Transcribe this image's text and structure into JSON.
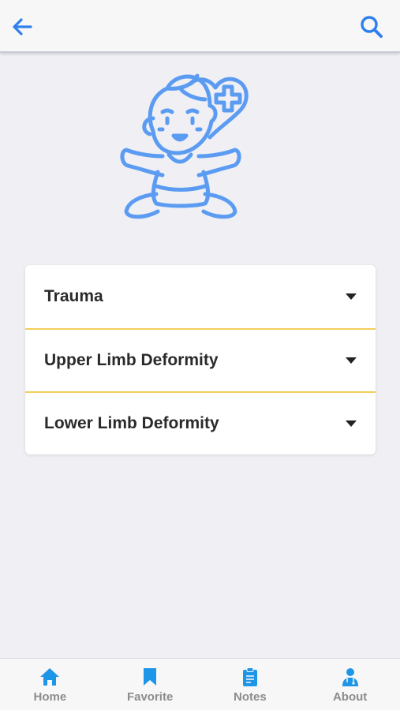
{
  "header": {
    "back_icon": "arrow-left-icon",
    "search_icon": "search-icon",
    "accent_color": "#2f80ed"
  },
  "hero": {
    "illustration": "baby-with-heart-plus-icon",
    "color": "#5b9cf2"
  },
  "sections": [
    {
      "label": "Trauma",
      "icon": "caret-down-icon"
    },
    {
      "label": "Upper Limb Deformity",
      "icon": "caret-down-icon"
    },
    {
      "label": "Lower Limb Deformity",
      "icon": "caret-down-icon"
    }
  ],
  "divider_color": "#f2cf5b",
  "tabs": [
    {
      "label": "Home",
      "icon": "home-icon"
    },
    {
      "label": "Favorite",
      "icon": "bookmark-icon"
    },
    {
      "label": "Notes",
      "icon": "clipboard-icon"
    },
    {
      "label": "About",
      "icon": "doctor-icon"
    }
  ],
  "tab_icon_color": "#1e96e8"
}
